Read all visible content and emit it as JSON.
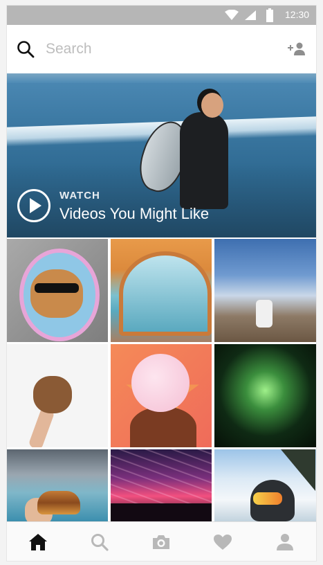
{
  "status_bar": {
    "time": "12:30",
    "icons": [
      "wifi-icon",
      "cellular-signal-icon",
      "battery-icon"
    ]
  },
  "top_bar": {
    "search_placeholder": "Search",
    "icons": [
      "search-icon",
      "add-person-icon"
    ]
  },
  "hero": {
    "overline": "WATCH",
    "title": "Videos You Might Like",
    "icon": "play-circle-icon"
  },
  "grid": {
    "tiles": [
      "cat-in-mirror-photo",
      "tent-view-photo",
      "canyon-proposal-photo",
      "dog-held-up-photo",
      "cotton-candy-photo",
      "fireworks-photo",
      "burger-at-beach-photo",
      "concert-lights-photo",
      "skier-selfie-photo"
    ]
  },
  "bottom_nav": {
    "items": [
      "home-icon",
      "search-icon",
      "camera-icon",
      "heart-icon",
      "profile-icon"
    ],
    "active": "home-icon"
  },
  "colors": {
    "status_bar_bg": "#b6b6b6",
    "active_icon": "#111111",
    "inactive_icon": "#b8b8b8"
  }
}
